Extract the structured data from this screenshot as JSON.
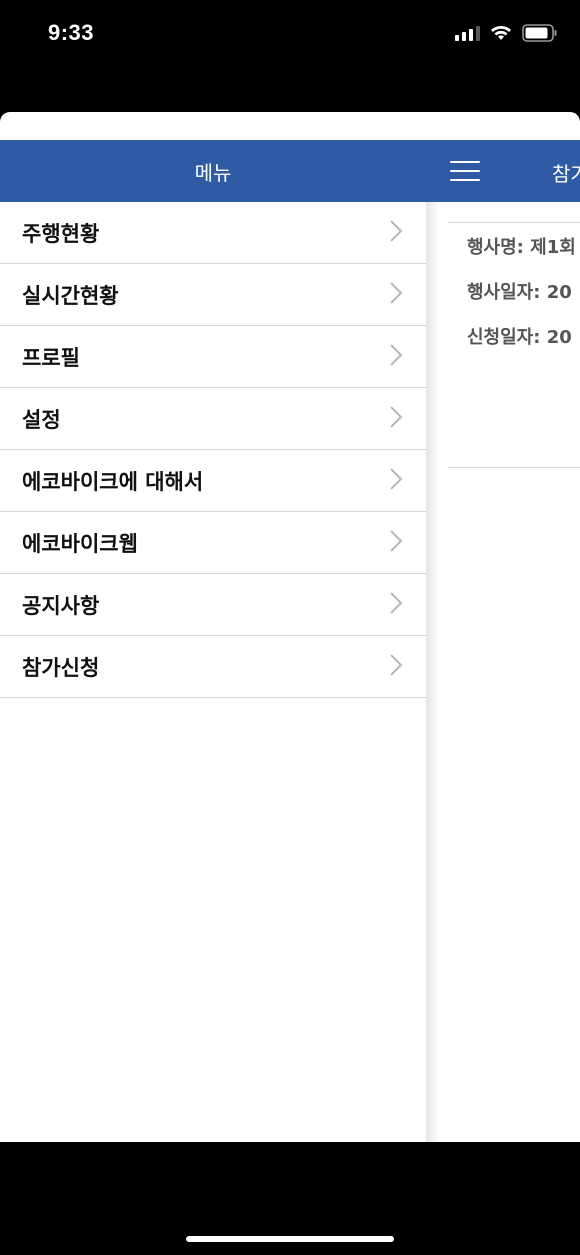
{
  "status_bar": {
    "time": "9:33"
  },
  "side_menu": {
    "title": "메뉴",
    "items": [
      {
        "label": "주행현황"
      },
      {
        "label": "실시간현황"
      },
      {
        "label": "프로필"
      },
      {
        "label": "설정"
      },
      {
        "label": "에코바이크에 대해서"
      },
      {
        "label": "에코바이크웹"
      },
      {
        "label": "공지사항"
      },
      {
        "label": "참가신청"
      }
    ]
  },
  "main": {
    "title": "참가",
    "event": {
      "name": "행사명: 제1회",
      "event_date": "행사일자: 20",
      "apply_date": "신청일자: 20"
    }
  },
  "colors": {
    "header_bg": "#2f5ba4",
    "divider": "#d6d6d6"
  },
  "icons": {
    "menu_toggle": "hamburger-icon",
    "row_arrow": "chevron-right-icon"
  }
}
